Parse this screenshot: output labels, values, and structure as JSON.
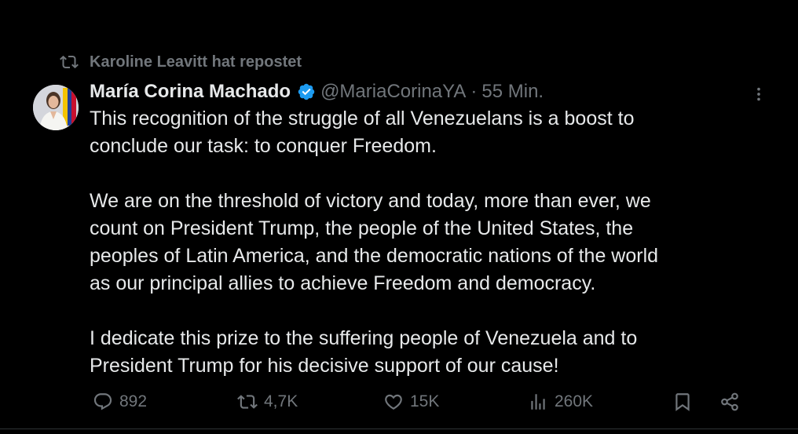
{
  "repost": {
    "text": "Karoline Leavitt hat repostet"
  },
  "author": {
    "name": "María Corina Machado",
    "handle": "@MariaCorinaYA",
    "separator": "·",
    "time": "55 Min."
  },
  "body": {
    "paragraphs": [
      [
        "This recognition of the struggle of all Venezuelans is a boost to",
        "conclude our task: to conquer Freedom."
      ],
      [
        "We are on the threshold of victory and today, more than ever, we",
        "count on President Trump, the people of the United States, the",
        "peoples of Latin America, and the democratic nations of the world",
        "as our principal allies to achieve Freedom and democracy."
      ],
      [
        "I dedicate this prize to the suffering people of Venezuela and to",
        "President Trump for his decisive support of our cause!"
      ]
    ]
  },
  "actions": {
    "replies": "892",
    "reposts": "4,7K",
    "likes": "15K",
    "views": "260K"
  },
  "colors": {
    "background": "#000000",
    "text": "#e7e9ea",
    "secondary": "#71767b",
    "verified": "#1d9bf0"
  }
}
